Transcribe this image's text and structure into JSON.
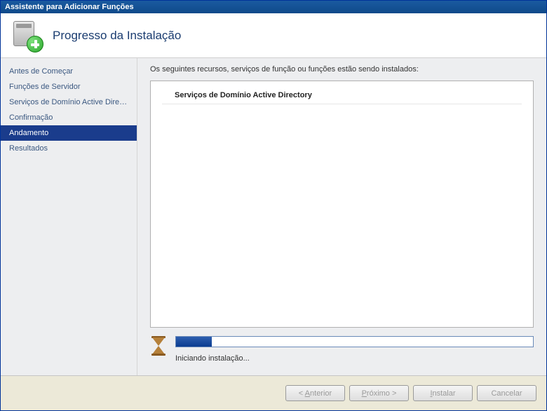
{
  "window": {
    "title": "Assistente para Adicionar Funções"
  },
  "header": {
    "title": "Progresso da Instalação"
  },
  "sidebar": {
    "steps": [
      {
        "label": "Antes de Começar",
        "selected": false
      },
      {
        "label": "Funções de Servidor",
        "selected": false
      },
      {
        "label": "Serviços de Domínio Active Direct...",
        "selected": false
      },
      {
        "label": "Confirmação",
        "selected": false
      },
      {
        "label": "Andamento",
        "selected": true
      },
      {
        "label": "Resultados",
        "selected": false
      }
    ]
  },
  "main": {
    "intro": "Os seguintes recursos, serviços de função ou funções estão sendo instalados:",
    "installing_item": "Serviços de Domínio Active Directory",
    "status_text": "Iniciando instalação...",
    "progress_percent": 10
  },
  "footer": {
    "back_prefix": "< ",
    "back_mnemonic": "A",
    "back_rest": "nterior",
    "next_mnemonic": "P",
    "next_rest": "róximo >",
    "install_mnemonic": "I",
    "install_rest": "nstalar",
    "cancel_label": "Cancelar"
  }
}
